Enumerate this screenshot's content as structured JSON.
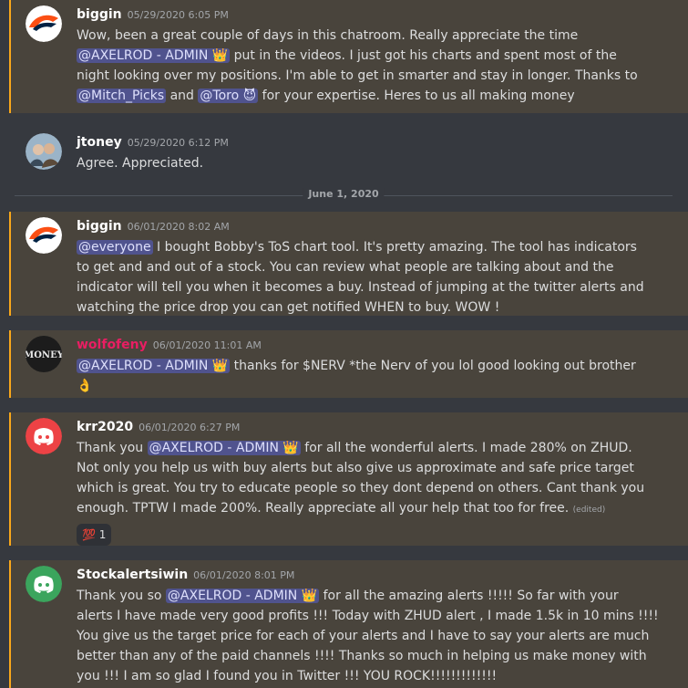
{
  "divider_label": "June 1, 2020",
  "messages": [
    {
      "author": "biggin",
      "timestamp": "05/29/2020 6:05 PM",
      "avatar": "broncos-logo-icon",
      "lines": [
        [
          "Wow, been a great couple of days in this chatroom. Really appreciate the time"
        ],
        [
          "@AXELROD - ADMIN 👑",
          " put in the videos. I just got his charts and spent most of the"
        ],
        [
          "night looking over my positions. I'm able to get in smarter and stay in longer. Thanks to"
        ],
        [
          "@Mitch_Picks",
          " and ",
          "@Toro 😈",
          " for your expertise. Heres to us all making money"
        ]
      ]
    },
    {
      "author": "jtoney",
      "timestamp": "05/29/2020 6:12 PM",
      "avatar": "user-photo-avatar",
      "text": "Agree. Appreciated."
    },
    {
      "author": "biggin",
      "timestamp": "06/01/2020 8:02 AM",
      "avatar": "broncos-logo-icon",
      "lines": [
        [
          "@everyone",
          " I bought Bobby's ToS chart tool.  It's pretty amazing.  The tool has indicators"
        ],
        [
          "to get and and out of a stock.  You can review what people are talking about and the"
        ],
        [
          "indicator will tell you when it becomes a buy.  Instead of jumping at the twitter alerts and"
        ],
        [
          "watching the price drop you can get notified WHEN to buy.  WOW !"
        ]
      ]
    },
    {
      "author": "wolfofeny",
      "timestamp": "06/01/2020 11:01 AM",
      "avatar": "money-logo-avatar",
      "avatar_text": "MONEY",
      "lines": [
        [
          "@AXELROD - ADMIN 👑",
          "  thanks for $NERV *the Nerv of you lol good looking out brother"
        ],
        [
          "👌"
        ]
      ]
    },
    {
      "author": "krr2020",
      "timestamp": "06/01/2020 6:27 PM",
      "avatar": "discord-logo-icon",
      "lines": [
        [
          "Thank you ",
          "@AXELROD - ADMIN 👑",
          "  for all the wonderful alerts. I made 280% on ZHUD."
        ],
        [
          "Not only you help us  with buy alerts but also give us approximate and safe price target"
        ],
        [
          "which is great. You try to educate people so they dont depend on others. Cant thank you"
        ],
        [
          "enough. TPTW I made 200%. Really appreciate all your help that too for free."
        ]
      ],
      "edited": "(edited)",
      "reaction": {
        "emoji": "💯",
        "count": "1"
      }
    },
    {
      "author": "Stockalertsiwin",
      "timestamp": "06/01/2020 8:01 PM",
      "avatar": "discord-logo-icon",
      "lines": [
        [
          "Thank you so ",
          "@AXELROD - ADMIN 👑",
          " for all the amazing alerts !!!!! So far with your"
        ],
        [
          "alerts I have made very good profits !!! Today with ZHUD alert , I made 1.5k in 10 mins !!!!"
        ],
        [
          "You give us the target price for each of your alerts and I have to say your alerts are much"
        ],
        [
          "better than any of the paid channels !!!! Thanks so much in helping us make money with"
        ],
        [
          "you !!! I am so glad I found you in Twitter !!! YOU ROCK!!!!!!!!!!!!!"
        ]
      ]
    }
  ]
}
